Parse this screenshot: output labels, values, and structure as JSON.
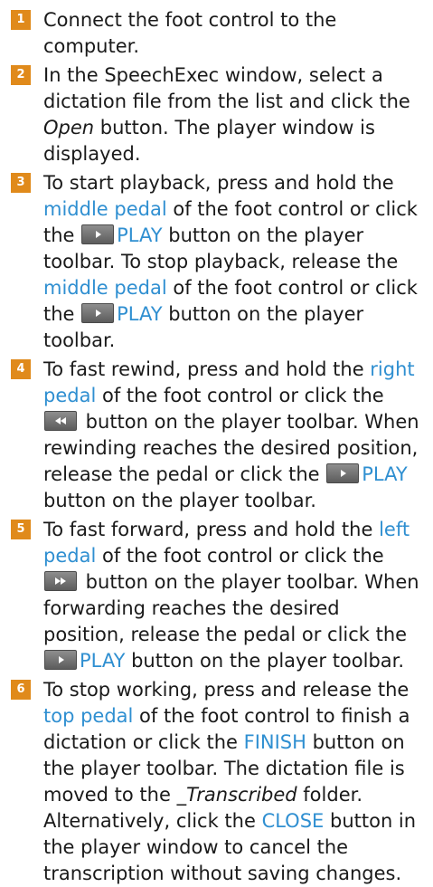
{
  "steps": [
    {
      "number": "1",
      "parts": [
        {
          "t": "Connect the foot control to the computer."
        }
      ]
    },
    {
      "number": "2",
      "parts": [
        {
          "t": "In the SpeechExec window, select a dictation file from the list and click the "
        },
        {
          "t": "Open",
          "s": "it"
        },
        {
          "t": " button. The player window is displayed."
        }
      ]
    },
    {
      "number": "3",
      "parts": [
        {
          "t": "To start playback, press and hold the "
        },
        {
          "t": "middle pedal",
          "s": "hl"
        },
        {
          "t": " of the foot control or click the "
        },
        {
          "icon": "play-icon"
        },
        {
          "t": "PLAY",
          "s": "hl"
        },
        {
          "t": " button on the player toolbar. To stop playback, release the "
        },
        {
          "t": "middle pedal",
          "s": "hl"
        },
        {
          "t": " of the foot control or click the "
        },
        {
          "icon": "play-icon"
        },
        {
          "t": "PLAY",
          "s": "hl"
        },
        {
          "t": " button on the player toolbar."
        }
      ]
    },
    {
      "number": "4",
      "parts": [
        {
          "t": "To fast rewind, press and hold the "
        },
        {
          "t": "right pedal",
          "s": "hl"
        },
        {
          "t": " of the foot control or click the "
        },
        {
          "icon": "rewind-icon"
        },
        {
          "t": " button on the player toolbar. When rewinding reaches the desired position, release the pedal or click the "
        },
        {
          "icon": "play-icon"
        },
        {
          "t": "PLAY",
          "s": "hl"
        },
        {
          "t": " button on the player toolbar."
        }
      ]
    },
    {
      "number": "5",
      "parts": [
        {
          "t": "To fast forward, press and hold the "
        },
        {
          "t": "left pedal",
          "s": "hl"
        },
        {
          "t": " of the foot control or click the "
        },
        {
          "icon": "fast-forward-icon"
        },
        {
          "t": " button on the player toolbar. When forwarding reaches the desired position, release the pedal or click the "
        },
        {
          "icon": "play-icon"
        },
        {
          "t": "PLAY",
          "s": "hl"
        },
        {
          "t": " button on the player toolbar."
        }
      ]
    },
    {
      "number": "6",
      "parts": [
        {
          "t": "To stop working, press and release the "
        },
        {
          "t": "top pedal",
          "s": "hl"
        },
        {
          "t": " of the foot control to finish a dictation or click the "
        },
        {
          "t": "FINISH",
          "s": "hl"
        },
        {
          "t": " button on the player toolbar. The dictation file is moved to the "
        },
        {
          "t": "_Transcribed",
          "s": "it"
        },
        {
          "t": " folder. Alternatively, click the "
        },
        {
          "t": "CLOSE",
          "s": "hl"
        },
        {
          "t": " button in the player window to cancel the transcription without saving changes."
        }
      ]
    }
  ],
  "colors": {
    "number_badge": "#e08a1b",
    "highlight_text": "#2f8fd1"
  }
}
